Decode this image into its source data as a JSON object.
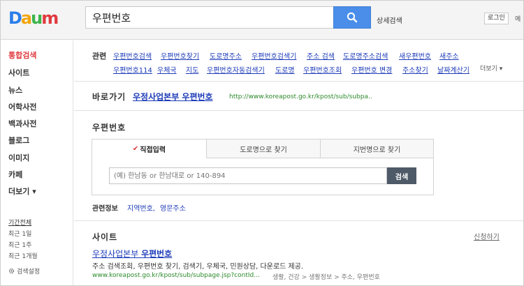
{
  "header": {
    "logo_letters": [
      "D",
      "a",
      "u",
      "m"
    ],
    "logo_colors": [
      "#2b7de9",
      "#f2a50c",
      "#3bb54a",
      "#e0393e"
    ],
    "search_value": "우편번호",
    "advanced_search": "상세검색",
    "login": "로그인",
    "edge_text": "메"
  },
  "nav": {
    "items": [
      {
        "label": "통합검색",
        "active": true
      },
      {
        "label": "사이트"
      },
      {
        "label": "뉴스"
      },
      {
        "label": "어학사전"
      },
      {
        "label": "백과사전"
      },
      {
        "label": "블로그"
      },
      {
        "label": "이미지"
      },
      {
        "label": "카페"
      },
      {
        "label": "더보기 ▾"
      }
    ],
    "period_head": "기간전체",
    "periods": [
      "최근 1일",
      "최근 1주",
      "최근 1개월"
    ],
    "search_settings": "검색설정"
  },
  "related": {
    "label": "관련",
    "row1": [
      "우편번호검색",
      "우편번호찾기",
      "도로명주소",
      "우편번호검색기",
      "주소 검색",
      "도로명주소검색",
      "새우편번호",
      "새주소"
    ],
    "row2": [
      "우편번호114",
      "우체국",
      "지도",
      "우편번호자동검색기",
      "도로명",
      "우편번호조회",
      "우편번호 변경",
      "주소찾기",
      "날짜계산기"
    ],
    "more": "더보기 ▾"
  },
  "shortcut": {
    "label": "바로가기",
    "link": "우정사업본부 우편번호",
    "url": "http://www.koreapost.go.kr/kpost/sub/subpa.."
  },
  "zip": {
    "title": "우편번호",
    "tabs": [
      "직접입력",
      "도로명으로 찾기",
      "지번명으로 찾기"
    ],
    "placeholder": "(예) 한남동 or 한남대로 or 140-894",
    "button": "검색",
    "related_label": "관련정보",
    "related_links": [
      "지역번호,",
      "영문주소"
    ]
  },
  "site": {
    "title": "사이트",
    "report": "신청하기",
    "link_prefix": "우정사업본부 ",
    "link_bold": "우편번호",
    "desc": "주소 검색조회, 우편번호 찾기, 검색기, 우체국, 민원상담, 다운로드 제공.",
    "url": "www.koreapost.go.kr/kpost/sub/subpage.jsp?contId...",
    "category": "생활, 건강 > 생활정보 > 주소, 우편번호"
  }
}
